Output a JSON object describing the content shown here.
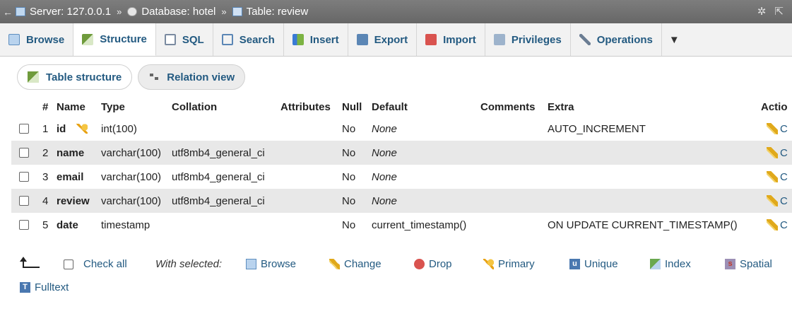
{
  "breadcrumb": {
    "back": "←",
    "server": "Server: 127.0.0.1",
    "database": "Database: hotel",
    "table": "Table: review",
    "separator": "»"
  },
  "tabs": [
    {
      "label": "Browse",
      "icon": "browse-icon"
    },
    {
      "label": "Structure",
      "icon": "structure-icon",
      "active": true
    },
    {
      "label": "SQL",
      "icon": "sql-icon"
    },
    {
      "label": "Search",
      "icon": "search-icon"
    },
    {
      "label": "Insert",
      "icon": "insert-icon"
    },
    {
      "label": "Export",
      "icon": "export-icon"
    },
    {
      "label": "Import",
      "icon": "import-icon"
    },
    {
      "label": "Privileges",
      "icon": "privileges-icon"
    },
    {
      "label": "Operations",
      "icon": "operations-icon"
    },
    {
      "label": "▼",
      "icon": "more-icon"
    }
  ],
  "subtabs": {
    "table_structure": "Table structure",
    "relation_view": "Relation view"
  },
  "table": {
    "headers": {
      "num": "#",
      "name": "Name",
      "type": "Type",
      "collation": "Collation",
      "attributes": "Attributes",
      "null": "Null",
      "default": "Default",
      "comments": "Comments",
      "extra": "Extra",
      "action": "Actio"
    },
    "rows": [
      {
        "num": "1",
        "name": "id",
        "type": "int(100)",
        "collation": "",
        "null": "No",
        "default": "None",
        "extra": "AUTO_INCREMENT",
        "action": "C"
      },
      {
        "num": "2",
        "name": "name",
        "type": "varchar(100)",
        "collation": "utf8mb4_general_ci",
        "null": "No",
        "default": "None",
        "extra": "",
        "action": "C"
      },
      {
        "num": "3",
        "name": "email",
        "type": "varchar(100)",
        "collation": "utf8mb4_general_ci",
        "null": "No",
        "default": "None",
        "extra": "",
        "action": "C"
      },
      {
        "num": "4",
        "name": "review",
        "type": "varchar(100)",
        "collation": "utf8mb4_general_ci",
        "null": "No",
        "default": "None",
        "extra": "",
        "action": "C"
      },
      {
        "num": "5",
        "name": "date",
        "type": "timestamp",
        "collation": "",
        "null": "No",
        "default": "current_timestamp()",
        "extra": "ON UPDATE CURRENT_TIMESTAMP()",
        "action": "C"
      }
    ]
  },
  "actions": {
    "check_all": "Check all",
    "with_selected": "With selected:",
    "browse": "Browse",
    "change": "Change",
    "drop": "Drop",
    "primary": "Primary",
    "unique": "Unique",
    "index": "Index",
    "spatial": "Spatial",
    "fulltext": "Fulltext"
  },
  "colors": {
    "link": "#235a81",
    "breadcrumb_bg": "#707070",
    "row_alt": "#e8e8e8"
  }
}
